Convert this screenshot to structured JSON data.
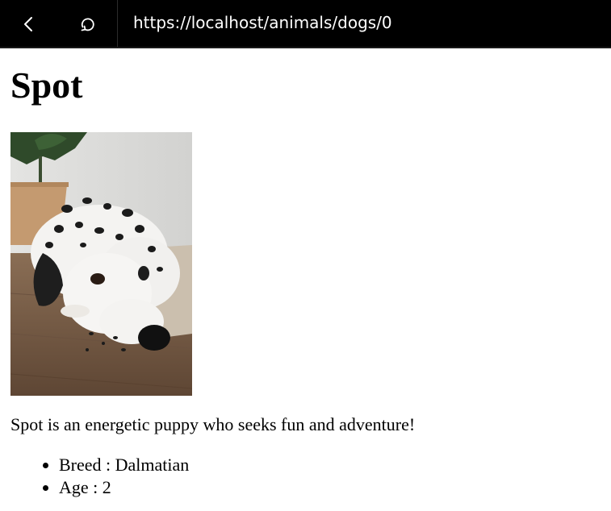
{
  "browser": {
    "url": "https://localhost/animals/dogs/0",
    "back_icon": "chevron-left-icon",
    "refresh_icon": "refresh-icon"
  },
  "page": {
    "title": "Spot",
    "image_subject": "dalmatian-dog-photo",
    "description": "Spot is an energetic puppy who seeks fun and adventure!",
    "details": [
      {
        "text": "Breed : Dalmatian"
      },
      {
        "text": "Age : 2"
      }
    ]
  },
  "colors": {
    "bar_background": "#000000",
    "bar_text": "#ffffff",
    "page_background": "#ffffff",
    "text": "#000000"
  }
}
